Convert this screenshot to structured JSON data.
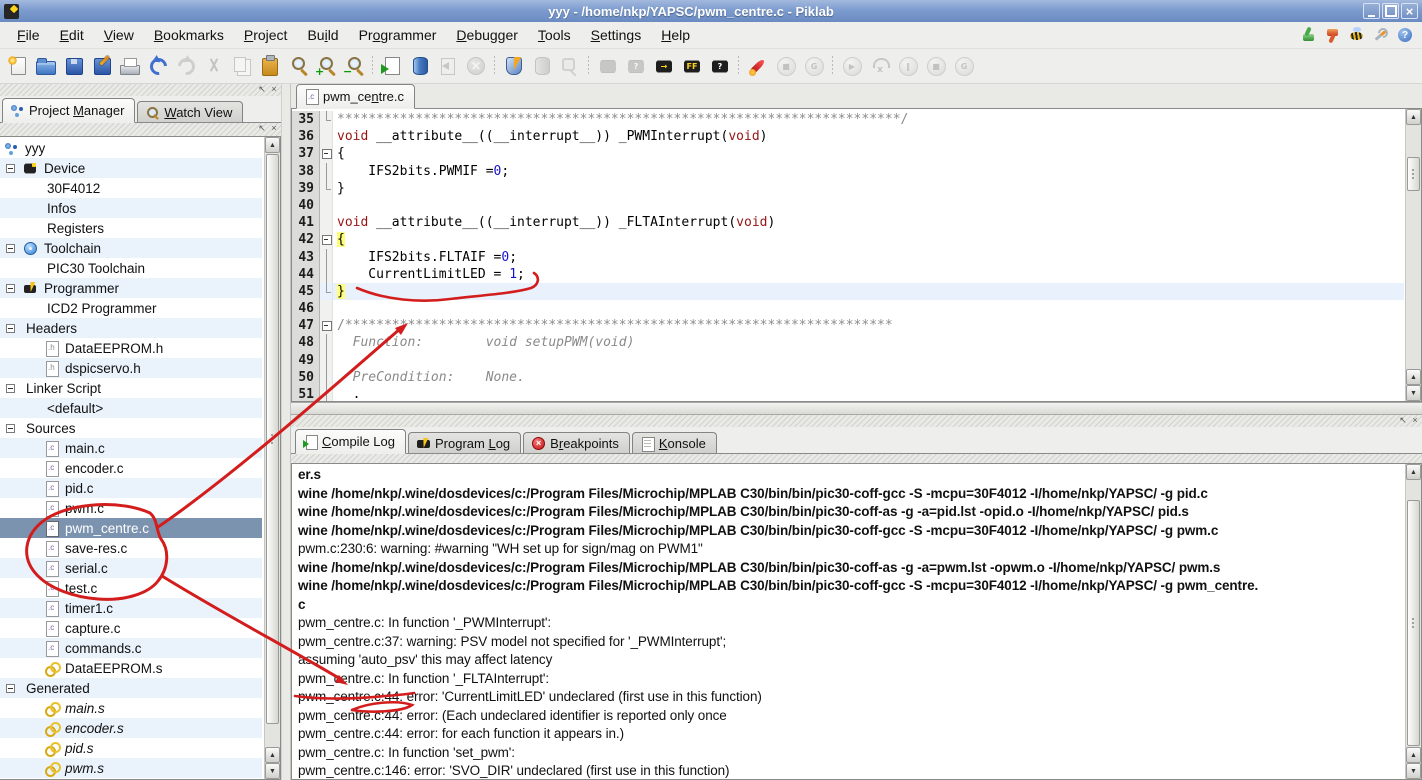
{
  "window": {
    "title": "yyy - /home/nkp/YAPSC/pwm_centre.c - Piklab"
  },
  "colors": {
    "annotation": "#d31d1d",
    "selection": "#7b93af",
    "keyword": "#991414",
    "number": "#1414cc",
    "comment": "#8a8a8a",
    "alt_row": "#eaf3fb",
    "current_line": "#e9f2fc",
    "brace_highlight": "#ffff7a",
    "titlebar": "#7d9ccf"
  },
  "menubar": {
    "items": [
      {
        "pre": "",
        "key": "F",
        "post": "ile"
      },
      {
        "pre": "",
        "key": "E",
        "post": "dit"
      },
      {
        "pre": "",
        "key": "V",
        "post": "iew"
      },
      {
        "pre": "",
        "key": "B",
        "post": "ookmarks"
      },
      {
        "pre": "",
        "key": "P",
        "post": "roject"
      },
      {
        "pre": "Bu",
        "key": "i",
        "post": "ld"
      },
      {
        "pre": "Pr",
        "key": "o",
        "post": "grammer"
      },
      {
        "pre": "",
        "key": "D",
        "post": "ebugger"
      },
      {
        "pre": "",
        "key": "T",
        "post": "ools"
      },
      {
        "pre": "",
        "key": "S",
        "post": "ettings"
      },
      {
        "pre": "",
        "key": "H",
        "post": "elp"
      }
    ],
    "right_icons": [
      {
        "name": "feedback-positive",
        "kind": "thumb up"
      },
      {
        "name": "feedback-negative",
        "kind": "thumb down"
      },
      {
        "name": "report-bug",
        "kind": "bee"
      },
      {
        "name": "configure",
        "kind": "wrench"
      },
      {
        "name": "whats-this",
        "kind": "qhelp"
      }
    ]
  },
  "toolbar": {
    "groups": [
      [
        {
          "name": "new-file",
          "kind": "doc new"
        },
        {
          "name": "open-file",
          "kind": "folder"
        },
        {
          "name": "save-file",
          "kind": "floppy"
        },
        {
          "name": "save-as",
          "kind": "floppy edit"
        },
        {
          "name": "print",
          "kind": "printer"
        },
        {
          "name": "undo",
          "kind": "undo"
        },
        {
          "name": "redo",
          "kind": "redo",
          "disabled": true
        },
        {
          "name": "cut",
          "kind": "cut",
          "disabled": true
        },
        {
          "name": "copy",
          "kind": "copy",
          "disabled": true
        },
        {
          "name": "paste",
          "kind": "paste"
        },
        {
          "name": "find",
          "kind": "mag"
        },
        {
          "name": "find-next",
          "kind": "mag plus",
          "glyph": "+"
        },
        {
          "name": "find-previous",
          "kind": "mag minus",
          "glyph": "−"
        }
      ],
      [
        {
          "name": "compile-file",
          "kind": "pagego"
        },
        {
          "name": "program-memory",
          "kind": "cyl"
        },
        {
          "name": "disassemble-file",
          "kind": "pageback",
          "disabled": true
        },
        {
          "name": "stop-operations",
          "kind": "circx",
          "disabled": true
        }
      ],
      [
        {
          "name": "build-project",
          "kind": "shield"
        },
        {
          "name": "library",
          "kind": "cyl gray",
          "disabled": true
        },
        {
          "name": "connect",
          "kind": "plug",
          "disabled": true
        }
      ],
      [
        {
          "name": "program-device",
          "kind": "chip gray",
          "disabled": true
        },
        {
          "name": "verify-device",
          "kind": "chip gray",
          "glyph": "?",
          "disabled": true
        },
        {
          "name": "read-device",
          "kind": "chip",
          "glyph": "→"
        },
        {
          "name": "erase-device",
          "kind": "chip ff",
          "glyph": "FF"
        },
        {
          "name": "blank-check-device",
          "kind": "chip q",
          "glyph": "?"
        }
      ],
      [
        {
          "name": "run",
          "kind": "rocket"
        },
        {
          "name": "stop",
          "kind": "circ",
          "glyph": "■",
          "disabled": true
        },
        {
          "name": "restart",
          "kind": "circ",
          "glyph": "G",
          "disabled": true
        }
      ],
      [
        {
          "name": "debug-run",
          "kind": "circ",
          "glyph": "▶",
          "disabled": true
        },
        {
          "name": "debug-step",
          "kind": "step",
          "glyph": "x",
          "disabled": true
        },
        {
          "name": "debug-pause",
          "kind": "circ",
          "glyph": "‖",
          "disabled": true
        },
        {
          "name": "debug-stop",
          "kind": "circ",
          "glyph": "■",
          "disabled": true
        },
        {
          "name": "debug-reset",
          "kind": "circ",
          "glyph": "G",
          "disabled": true
        }
      ]
    ]
  },
  "sidebar": {
    "tabs": [
      {
        "name": "tab-project-manager",
        "pre": "Project ",
        "key": "M",
        "post": "anager",
        "icon": "project-cluster",
        "active": true
      },
      {
        "name": "tab-watch-view",
        "pre": "",
        "key": "W",
        "post": "atch View",
        "icon": "magnifier",
        "active": false
      }
    ],
    "tree": [
      {
        "label": "yyy",
        "depth": 0,
        "icon": "project"
      },
      {
        "label": "Device",
        "depth": 1,
        "exp": true,
        "icon": "chip"
      },
      {
        "label": "30F4012",
        "depth": 2
      },
      {
        "label": "Infos",
        "depth": 2
      },
      {
        "label": "Registers",
        "depth": 2
      },
      {
        "label": "Toolchain",
        "depth": 1,
        "exp": true,
        "icon": "gear"
      },
      {
        "label": "PIC30 Toolchain",
        "depth": 2
      },
      {
        "label": "Programmer",
        "depth": 1,
        "exp": true,
        "icon": "chip-flash"
      },
      {
        "label": "ICD2 Programmer",
        "depth": 2
      },
      {
        "label": "Headers",
        "depth": 1,
        "exp": true
      },
      {
        "label": "DataEEPROM.h",
        "depth": 2,
        "icon": "h-file"
      },
      {
        "label": "dspicservo.h",
        "depth": 2,
        "icon": "h-file"
      },
      {
        "label": "Linker Script",
        "depth": 1,
        "exp": true
      },
      {
        "label": "<default>",
        "depth": 2
      },
      {
        "label": "Sources",
        "depth": 1,
        "exp": true
      },
      {
        "label": "main.c",
        "depth": 2,
        "icon": "c-file"
      },
      {
        "label": "encoder.c",
        "depth": 2,
        "icon": "c-file"
      },
      {
        "label": "pid.c",
        "depth": 2,
        "icon": "c-file"
      },
      {
        "label": "pwm.c",
        "depth": 2,
        "icon": "c-file"
      },
      {
        "label": "pwm_centre.c",
        "depth": 2,
        "icon": "c-file",
        "sel": true
      },
      {
        "label": "save-res.c",
        "depth": 2,
        "icon": "c-file"
      },
      {
        "label": "serial.c",
        "depth": 2,
        "icon": "c-file"
      },
      {
        "label": "test.c",
        "depth": 2,
        "icon": "c-file"
      },
      {
        "label": "timer1.c",
        "depth": 2,
        "icon": "c-file"
      },
      {
        "label": "capture.c",
        "depth": 2,
        "icon": "c-file"
      },
      {
        "label": "commands.c",
        "depth": 2,
        "icon": "c-file"
      },
      {
        "label": "DataEEPROM.s",
        "depth": 2,
        "icon": "s-file"
      },
      {
        "label": "Generated",
        "depth": 1,
        "exp": true
      },
      {
        "label": "main.s",
        "depth": 2,
        "icon": "s-file",
        "italic": true
      },
      {
        "label": "encoder.s",
        "depth": 2,
        "icon": "s-file",
        "italic": true
      },
      {
        "label": "pid.s",
        "depth": 2,
        "icon": "s-file",
        "italic": true
      },
      {
        "label": "pwm.s",
        "depth": 2,
        "icon": "s-file",
        "italic": true
      }
    ]
  },
  "editor": {
    "tab": {
      "name": "editor-tab-pwm-centre-c",
      "pre": "pwm_ce",
      "key": "n",
      "post": "tre.c",
      "icon": "c-page",
      "active": true
    },
    "lines": [
      {
        "n": "35",
        "fold": "end",
        "segs": [
          [
            "************************************************************************/",
            "com"
          ]
        ]
      },
      {
        "n": "36",
        "fold": "",
        "segs": [
          [
            "void",
            "kw"
          ],
          [
            " __attribute__((__interrupt__)) _PWMInterrupt(",
            ""
          ],
          [
            "void",
            "kw"
          ],
          [
            ")",
            ""
          ]
        ]
      },
      {
        "n": "37",
        "fold": "box",
        "segs": [
          [
            "{",
            ""
          ]
        ]
      },
      {
        "n": "38",
        "fold": "v",
        "segs": [
          [
            "    IFS2bits.PWMIF =",
            ""
          ],
          [
            "0",
            "num"
          ],
          [
            ";",
            ""
          ]
        ]
      },
      {
        "n": "39",
        "fold": "end",
        "segs": [
          [
            "}",
            ""
          ]
        ]
      },
      {
        "n": "40",
        "fold": "",
        "segs": []
      },
      {
        "n": "41",
        "fold": "",
        "segs": [
          [
            "void",
            "kw"
          ],
          [
            " __attribute__((__interrupt__)) _FLTAInterrupt(",
            ""
          ],
          [
            "void",
            "kw"
          ],
          [
            ")",
            ""
          ]
        ]
      },
      {
        "n": "42",
        "fold": "box",
        "segs": [
          [
            "{",
            "brc"
          ]
        ]
      },
      {
        "n": "43",
        "fold": "v",
        "segs": [
          [
            "    IFS2bits.FLTAIF =",
            ""
          ],
          [
            "0",
            "num"
          ],
          [
            ";",
            ""
          ]
        ]
      },
      {
        "n": "44",
        "fold": "v",
        "segs": [
          [
            "    CurrentLimitLED = ",
            ""
          ],
          [
            "1",
            "num"
          ],
          [
            ";",
            ""
          ]
        ]
      },
      {
        "n": "45",
        "fold": "end",
        "hl": true,
        "segs": [
          [
            "}",
            "brc"
          ]
        ]
      },
      {
        "n": "46",
        "fold": "",
        "segs": []
      },
      {
        "n": "47",
        "fold": "box",
        "segs": [
          [
            "/**********************************************************************",
            "com"
          ]
        ]
      },
      {
        "n": "48",
        "fold": "v",
        "segs": [
          [
            "  Function:        void setupPWM(void)",
            "comi"
          ]
        ]
      },
      {
        "n": "49",
        "fold": "v",
        "segs": []
      },
      {
        "n": "50",
        "fold": "v",
        "segs": [
          [
            "  PreCondition:    None.",
            "comi"
          ]
        ]
      },
      {
        "n": "51",
        "fold": "v",
        "segs": [
          [
            "  .",
            ""
          ]
        ]
      }
    ]
  },
  "bottom": {
    "tabs": [
      {
        "name": "tab-compile-log",
        "pre": "",
        "key": "C",
        "post": "ompile Log",
        "icon": "page-green",
        "active": true
      },
      {
        "name": "tab-program-log",
        "pre": "Program ",
        "key": "L",
        "post": "og",
        "icon": "chip-bolt",
        "active": false
      },
      {
        "name": "tab-breakpoints",
        "pre": "B",
        "key": "r",
        "post": "eakpoints",
        "icon": "break-circle",
        "active": false
      },
      {
        "name": "tab-konsole",
        "pre": "",
        "key": "K",
        "post": "onsole",
        "icon": "page-plain",
        "active": false
      }
    ],
    "log": [
      {
        "text": "er.s",
        "bold": true
      },
      {
        "text": "wine /home/nkp/.wine/dosdevices/c:/Program Files/Microchip/MPLAB C30/bin/bin/pic30-coff-gcc -S -mcpu=30F4012 -I/home/nkp/YAPSC/ -g pid.c",
        "bold": true
      },
      {
        "text": "wine /home/nkp/.wine/dosdevices/c:/Program Files/Microchip/MPLAB C30/bin/bin/pic30-coff-as -g -a=pid.lst -opid.o -I/home/nkp/YAPSC/ pid.s",
        "bold": true
      },
      {
        "text": "wine /home/nkp/.wine/dosdevices/c:/Program Files/Microchip/MPLAB C30/bin/bin/pic30-coff-gcc -S -mcpu=30F4012 -I/home/nkp/YAPSC/ -g pwm.c",
        "bold": true
      },
      {
        "text": "pwm.c:230:6: warning: #warning \"WH set up for sign/mag on PWM1\"",
        "bold": false
      },
      {
        "text": "wine /home/nkp/.wine/dosdevices/c:/Program Files/Microchip/MPLAB C30/bin/bin/pic30-coff-as -g -a=pwm.lst -opwm.o -I/home/nkp/YAPSC/ pwm.s",
        "bold": true
      },
      {
        "text": "wine /home/nkp/.wine/dosdevices/c:/Program Files/Microchip/MPLAB C30/bin/bin/pic30-coff-gcc -S -mcpu=30F4012 -I/home/nkp/YAPSC/ -g pwm_centre.",
        "bold": true
      },
      {
        "text": "c",
        "bold": true
      },
      {
        "text": "pwm_centre.c: In function '_PWMInterrupt':",
        "bold": false
      },
      {
        "text": "pwm_centre.c:37: warning: PSV model not specified for '_PWMInterrupt';",
        "bold": false
      },
      {
        "text": "assuming 'auto_psv' this may affect latency",
        "bold": false
      },
      {
        "text": "pwm_centre.c: In function '_FLTAInterrupt':",
        "bold": false
      },
      {
        "text": "pwm_centre.c:44: error: 'CurrentLimitLED' undeclared (first use in this function)",
        "bold": false
      },
      {
        "text": "pwm_centre.c:44: error: (Each undeclared identifier is reported only once",
        "bold": false
      },
      {
        "text": "pwm_centre.c:44: error: for each function it appears in.)",
        "bold": false
      },
      {
        "text": "pwm_centre.c: In function 'set_pwm':",
        "bold": false
      },
      {
        "text": "pwm_centre.c:146: error: 'SVO_DIR' undeclared (first use in this function)",
        "bold": false
      }
    ]
  }
}
